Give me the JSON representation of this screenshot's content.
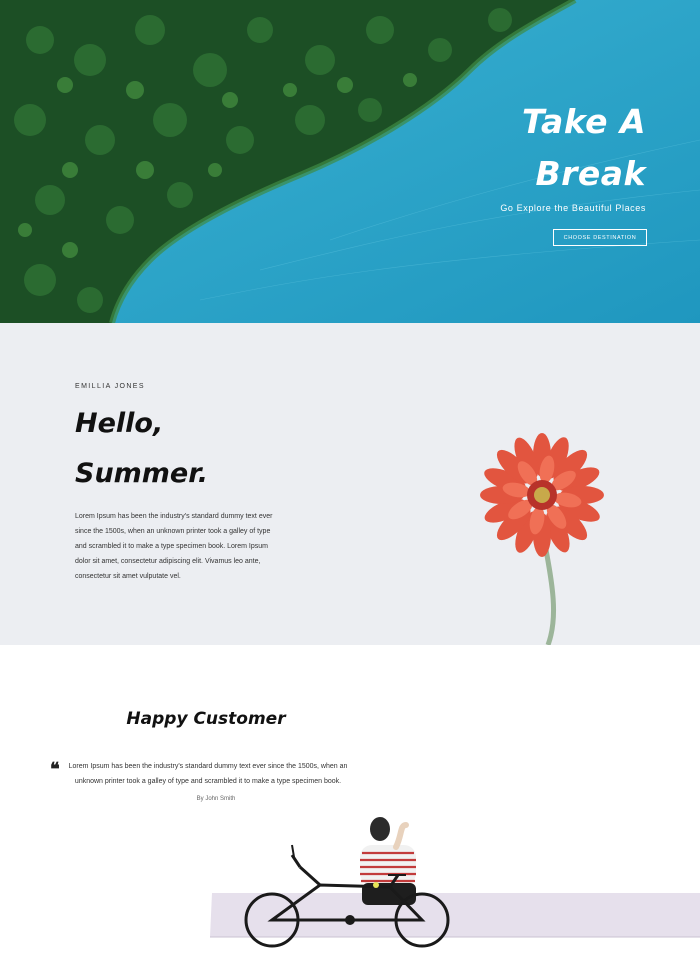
{
  "hero": {
    "title_line1": "Take A",
    "title_line2": "Break",
    "subtitle": "Go Explore the Beautiful Places",
    "button_label": "CHOOSE DESTINATION"
  },
  "summer": {
    "author": "EMILLIA JONES",
    "title_line1": "Hello,",
    "title_line2": "Summer.",
    "paragraph_lines": [
      "Lorem Ipsum has been the industry's standard dummy text ever",
      "since the 1500s, when an unknown printer took a galley of type",
      "and scrambled it to make a type specimen book. Lorem Ipsum",
      "dolor sit amet, consectetur adipiscing elit. Vivamus leo ante,",
      "consectetur sit amet vulputate vel."
    ]
  },
  "customer": {
    "title": "Happy Customer",
    "quote_mark": "❝",
    "quote_lines": [
      "Lorem Ipsum has been the industry's standard dummy text ever since the 1500s, when an",
      "unknown printer took a galley of type and scrambled it to make a type specimen book."
    ],
    "by": "By John Smith"
  },
  "colors": {
    "sea": "#2aa3c7",
    "forest": "#1f5a2a",
    "summer_bg": "#eceef2",
    "flower": "#e2553f"
  },
  "icons": {
    "quote": "quote-icon"
  }
}
